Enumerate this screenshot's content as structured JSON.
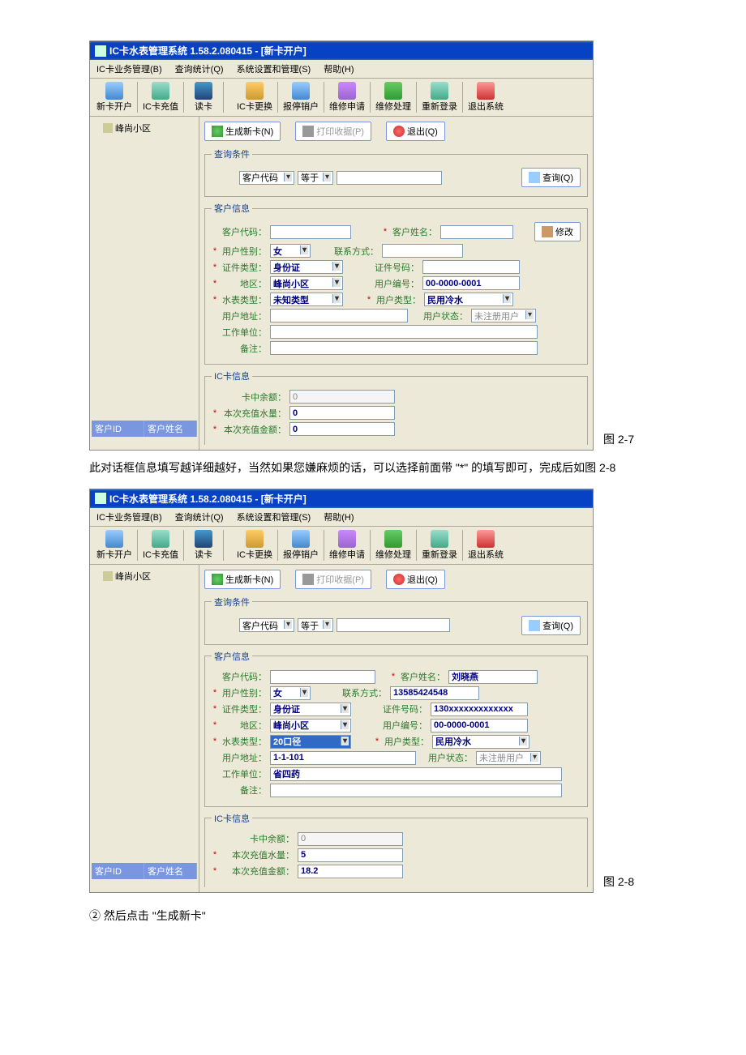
{
  "doc": {
    "fig1_label": "图 2-7",
    "body_text": "此对话框信息填写越详细越好，当然如果您嫌麻烦的话，可以选择前面带 \"*\" 的填写即可，完成后如图 2-8",
    "fig2_label": "图 2-8",
    "step_text": "② 然后点击 \"生成新卡\""
  },
  "win1": {
    "title": "IC卡水表管理系统 1.58.2.080415 - [新卡开户]",
    "menu": [
      "IC卡业务管理(B)",
      "查询统计(Q)",
      "系统设置和管理(S)",
      "帮助(H)"
    ],
    "toolbar": [
      "新卡开户",
      "IC卡充值",
      "读卡",
      "IC卡更换",
      "报停销户",
      "维修申请",
      "维修处理",
      "重新登录",
      "退出系统"
    ],
    "tree": "峰尚小区",
    "side_cols": [
      "客户ID",
      "客户姓名"
    ],
    "btns": {
      "gen": "生成新卡(N)",
      "print": "打印收据(P)",
      "exit": "退出(Q)",
      "query": "查询(Q)",
      "modify": "修改"
    },
    "fs": {
      "query": "查询条件",
      "cust": "客户信息",
      "ic": "IC卡信息"
    },
    "labels": {
      "custcode_sel": "客户代码",
      "op": "等于",
      "custcode": "客户代码：",
      "custname": "客户姓名：",
      "gender": "用户性别：",
      "contact": "联系方式：",
      "idtype": "证件类型：",
      "idno": "证件号码：",
      "region": "地区：",
      "userno": "用户编号：",
      "metertype": "水表类型：",
      "usertype": "用户类型：",
      "addr": "用户地址：",
      "status": "用户状态：",
      "work": "工作单位：",
      "remark": "备注：",
      "balance": "卡中余额：",
      "water": "本次充值水量：",
      "amount": "本次充值金额："
    },
    "vals": {
      "gender": "女",
      "idtype": "身份证",
      "region": "峰尚小区",
      "userno": "00-0000-0001",
      "metertype": "未知类型",
      "usertype": "民用冷水",
      "status": "未注册用户",
      "balance": "0",
      "water": "0",
      "amount": "0"
    }
  },
  "win2": {
    "title": "IC卡水表管理系统 1.58.2.080415 - [新卡开户]",
    "menu": [
      "IC卡业务管理(B)",
      "查询统计(Q)",
      "系统设置和管理(S)",
      "帮助(H)"
    ],
    "toolbar": [
      "新卡开户",
      "IC卡充值",
      "读卡",
      "IC卡更换",
      "报停销户",
      "维修申请",
      "维修处理",
      "重新登录",
      "退出系统"
    ],
    "tree": "峰尚小区",
    "side_cols": [
      "客户ID",
      "客户姓名"
    ],
    "btns": {
      "gen": "生成新卡(N)",
      "print": "打印收据(P)",
      "exit": "退出(Q)",
      "query": "查询(Q)"
    },
    "fs": {
      "query": "查询条件",
      "cust": "客户信息",
      "ic": "IC卡信息"
    },
    "labels": {
      "custcode_sel": "客户代码",
      "op": "等于",
      "custcode": "客户代码：",
      "custname": "客户姓名：",
      "gender": "用户性别：",
      "contact": "联系方式：",
      "idtype": "证件类型：",
      "idno": "证件号码：",
      "region": "地区：",
      "userno": "用户编号：",
      "metertype": "水表类型：",
      "usertype": "用户类型：",
      "addr": "用户地址：",
      "status": "用户状态：",
      "work": "工作单位：",
      "remark": "备注：",
      "balance": "卡中余额：",
      "water": "本次充值水量：",
      "amount": "本次充值金额："
    },
    "vals": {
      "custname": "刘晓燕",
      "gender": "女",
      "contact": "13585424548",
      "idtype": "身份证",
      "idno": "130xxxxxxxxxxxxx",
      "region": "峰尚小区",
      "userno": "00-0000-0001",
      "metertype": "20口径",
      "usertype": "民用冷水",
      "addr": "1-1-101",
      "status": "未注册用户",
      "work": "省四药",
      "balance": "0",
      "water": "5",
      "amount": "18.2"
    }
  }
}
